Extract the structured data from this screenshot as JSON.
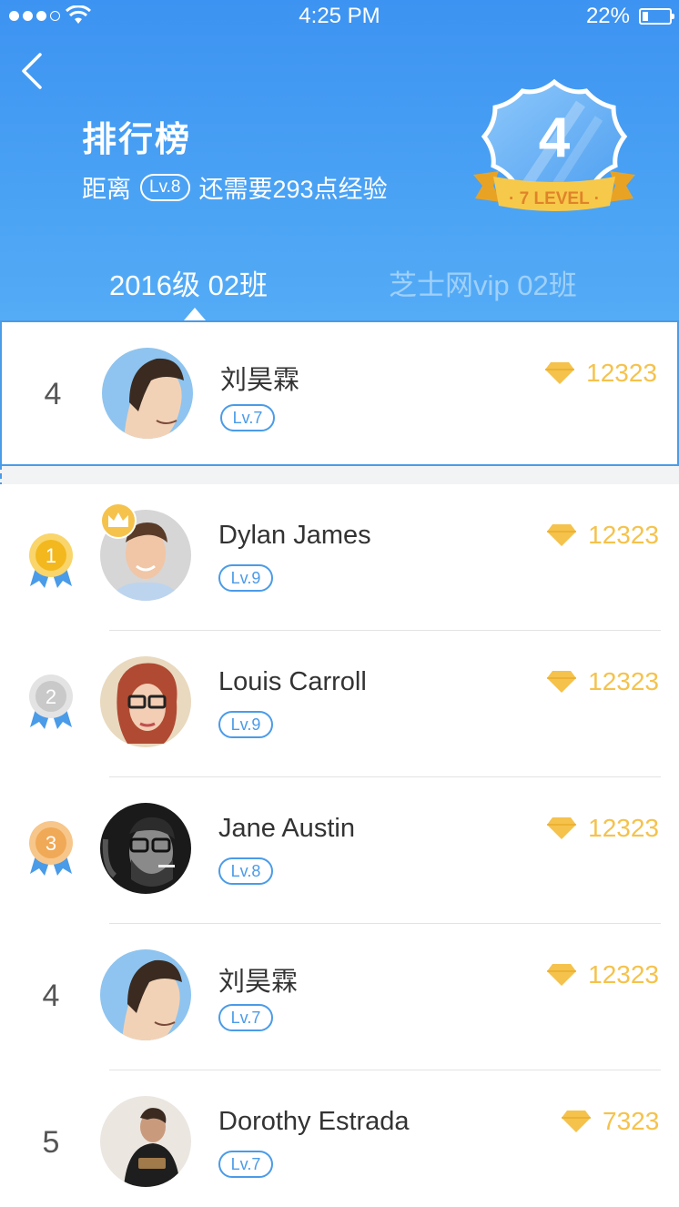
{
  "status_bar": {
    "time": "4:25 PM",
    "battery": "22%",
    "battery_level": 0.22
  },
  "header": {
    "title": "排行榜",
    "subtitle_prefix": "距离",
    "subtitle_level": "Lv.8",
    "subtitle_suffix": "还需要293点经验",
    "badge_number": "4",
    "badge_ribbon": "· 7 LEVEL ·"
  },
  "tabs": [
    {
      "label": "2016级 02班",
      "active": true
    },
    {
      "label": "芝士网vip 02班",
      "active": false
    }
  ],
  "my_rank": {
    "rank": "4",
    "name": "刘昊霖",
    "level": "Lv.7",
    "score": "12323"
  },
  "ranking": [
    {
      "rank": "1",
      "name": "Dylan James",
      "level": "Lv.9",
      "score": "12323",
      "medal": "gold",
      "crown": true
    },
    {
      "rank": "2",
      "name": "Louis Carroll",
      "level": "Lv.9",
      "score": "12323",
      "medal": "silver"
    },
    {
      "rank": "3",
      "name": "Jane Austin",
      "level": "Lv.8",
      "score": "12323",
      "medal": "bronze"
    },
    {
      "rank": "4",
      "name": "刘昊霖",
      "level": "Lv.7",
      "score": "12323"
    },
    {
      "rank": "5",
      "name": "Dorothy Estrada",
      "level": "Lv.7",
      "score": "7323"
    }
  ],
  "colors": {
    "header_blue": "#3d93f1",
    "accent_blue": "#4a9be8",
    "gem_yellow": "#f5c24c",
    "gold": "#f7c02e",
    "silver": "#c9c9c9",
    "bronze": "#f0a957"
  },
  "icons": {
    "back": "chevron-left-icon",
    "gem": "diamond-icon",
    "crown": "crown-icon",
    "medal": "medal-icon"
  }
}
